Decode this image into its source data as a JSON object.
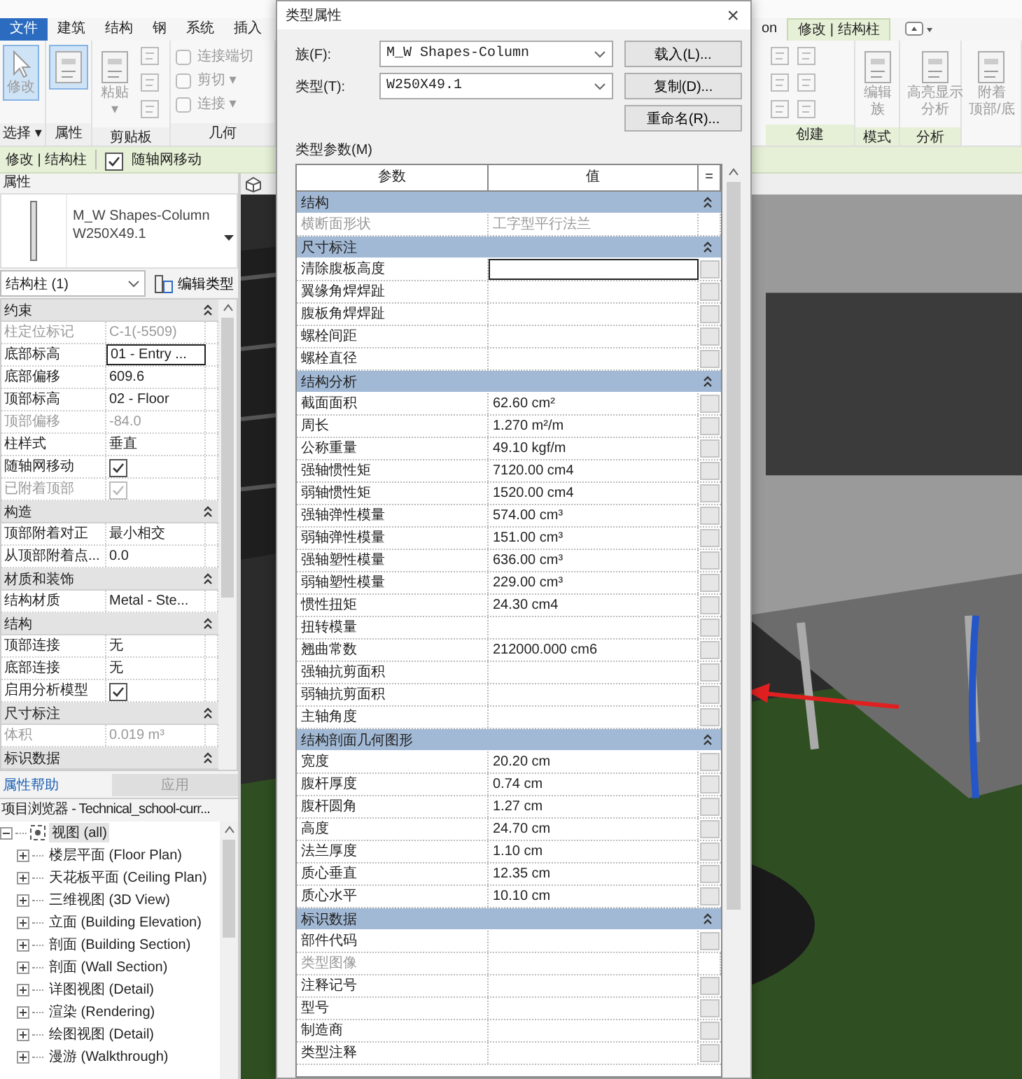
{
  "ribbon": {
    "tabs_left": [
      {
        "label": "文件",
        "kind": "menu",
        "selected": false
      },
      {
        "label": "建筑",
        "kind": "tab",
        "selected": false
      },
      {
        "label": "结构",
        "kind": "tab",
        "selected": false
      },
      {
        "label": "钢",
        "kind": "tab",
        "selected": false
      },
      {
        "label": "系统",
        "kind": "tab",
        "selected": false
      },
      {
        "label": "插入",
        "kind": "tab",
        "selected": false
      }
    ],
    "tabs_right": [
      {
        "label": "on",
        "selected": false
      },
      {
        "label": "修改 | 结构柱",
        "selected": true
      }
    ],
    "panels_left": [
      {
        "label": "选择 ▾",
        "tools": [
          {
            "kind": "large",
            "lines": [
              "修改"
            ],
            "disabled": true,
            "selected": true
          }
        ]
      },
      {
        "label": "属性",
        "tools": [
          {
            "kind": "large",
            "selected": true
          }
        ]
      },
      {
        "label": "剪贴板",
        "tools": [
          {
            "kind": "large",
            "lines": [
              "粘贴",
              "▾"
            ],
            "disabled": true,
            "selected": false
          },
          {
            "kind": "icons"
          }
        ]
      },
      {
        "label": "几何",
        "tools": [
          {
            "kind": "small",
            "lines": [
              "连接端切"
            ],
            "disabled": true
          },
          {
            "kind": "small",
            "lines": [
              "剪切 ▾"
            ],
            "disabled": true
          },
          {
            "kind": "small",
            "lines": [
              "连接 ▾"
            ],
            "disabled": true
          }
        ]
      }
    ],
    "panels_right": [
      {
        "label": "创建",
        "tools": [
          {
            "kind": "icons"
          },
          {
            "kind": "icons"
          }
        ]
      },
      {
        "label": "模式",
        "tools": [
          {
            "kind": "large",
            "lines": [
              "编辑",
              "族"
            ],
            "disabled": true,
            "selected": false
          }
        ]
      },
      {
        "label": "分析",
        "tools": [
          {
            "kind": "large",
            "lines": [
              "高亮显示",
              "分析"
            ],
            "disabled": true,
            "selected": false
          }
        ]
      },
      {
        "tools": [
          {
            "kind": "large",
            "lines": [
              "附着",
              "顶部/底"
            ],
            "disabled": true,
            "selected": false
          }
        ]
      }
    ]
  },
  "context_bar": {
    "label": "修改 | 结构柱",
    "option": {
      "label": "随轴网移动",
      "checked": true
    }
  },
  "properties": {
    "title": "属性",
    "type_name": "M_W Shapes-Column",
    "type_size": "W250X49.1",
    "filter": "结构柱 (1)",
    "edit_type": "编辑类型",
    "sections": [
      {
        "title": "约束",
        "rows": [
          {
            "kind": "text",
            "label": "柱定位标记",
            "value": "C-1(-5509)",
            "disabled": true
          },
          {
            "kind": "edit",
            "label": "底部标高",
            "value": "01 - Entry ...",
            "disabled": false
          },
          {
            "kind": "text",
            "label": "底部偏移",
            "value": "609.6",
            "disabled": false
          },
          {
            "kind": "text",
            "label": "顶部标高",
            "value": "02 - Floor",
            "disabled": false
          },
          {
            "kind": "text",
            "label": "顶部偏移",
            "value": "-84.0",
            "disabled": true
          },
          {
            "kind": "text",
            "label": "柱样式",
            "value": "垂直",
            "disabled": false
          },
          {
            "kind": "check",
            "label": "随轴网移动",
            "checked": true,
            "disabled": false
          },
          {
            "kind": "check",
            "label": "已附着顶部",
            "checked": true,
            "disabled": true
          }
        ]
      },
      {
        "title": "构造",
        "rows": [
          {
            "kind": "text",
            "label": "顶部附着对正",
            "value": "最小相交",
            "disabled": false
          },
          {
            "kind": "text",
            "label": "从顶部附着点...",
            "value": "0.0",
            "disabled": false
          }
        ]
      },
      {
        "title": "材质和装饰",
        "rows": [
          {
            "kind": "text",
            "label": "结构材质",
            "value": "Metal - Ste...",
            "disabled": false
          }
        ]
      },
      {
        "title": "结构",
        "rows": [
          {
            "kind": "text",
            "label": "顶部连接",
            "value": "无",
            "disabled": false
          },
          {
            "kind": "text",
            "label": "底部连接",
            "value": "无",
            "disabled": false
          },
          {
            "kind": "check",
            "label": "启用分析模型",
            "checked": true,
            "disabled": false
          }
        ]
      },
      {
        "title": "尺寸标注",
        "rows": [
          {
            "kind": "text",
            "label": "体积",
            "value": "0.019 m³",
            "disabled": true
          }
        ]
      },
      {
        "title": "标识数据"
      }
    ],
    "help": "属性帮助",
    "apply": {
      "label": "应用",
      "disabled": true
    }
  },
  "browser": {
    "title": "项目浏览器 - Technical_school-curr...",
    "tree": [
      {
        "label": "视图 (all)",
        "expanded": true,
        "selected": true,
        "children": [
          {
            "label": "楼层平面 (Floor Plan)",
            "expanded": false,
            "selected": false
          },
          {
            "label": "天花板平面 (Ceiling Plan)",
            "expanded": false,
            "selected": false
          },
          {
            "label": "三维视图 (3D View)",
            "expanded": false,
            "selected": false
          },
          {
            "label": "立面 (Building Elevation)",
            "expanded": false,
            "selected": false
          },
          {
            "label": "剖面 (Building Section)",
            "expanded": false,
            "selected": false
          },
          {
            "label": "剖面 (Wall Section)",
            "expanded": false,
            "selected": false
          },
          {
            "label": "详图视图 (Detail)",
            "expanded": false,
            "selected": false
          },
          {
            "label": "渲染 (Rendering)",
            "expanded": false,
            "selected": false
          },
          {
            "label": "绘图视图 (Detail)",
            "expanded": false,
            "selected": false
          },
          {
            "label": "漫游 (Walkthrough)",
            "expanded": false,
            "selected": false
          }
        ]
      }
    ]
  },
  "dialog": {
    "title": "类型属性",
    "close": "×",
    "family_label": "族(F):",
    "family": "M_W Shapes-Column",
    "type_label": "类型(T):",
    "type": "W250X49.1",
    "buttons": [
      "载入(L)...",
      "复制(D)...",
      "重命名(R)..."
    ],
    "params_label": "类型参数(M)",
    "columns": [
      "参数",
      "值",
      "="
    ],
    "sections": [
      {
        "title": "结构",
        "rows": [
          {
            "label": "横断面形状",
            "value": "工字型平行法兰",
            "disabled": true
          }
        ]
      },
      {
        "title": "尺寸标注",
        "rows": [
          {
            "label": "清除腹板高度",
            "disabled": false,
            "editing": true
          },
          {
            "label": "翼缘角焊焊趾",
            "disabled": false
          },
          {
            "label": "腹板角焊焊趾",
            "disabled": false
          },
          {
            "label": "螺栓间距",
            "disabled": false
          },
          {
            "label": "螺栓直径",
            "disabled": false
          }
        ]
      },
      {
        "title": "结构分析",
        "rows": [
          {
            "label": "截面面积",
            "value": "62.60 cm²",
            "disabled": false
          },
          {
            "label": "周长",
            "value": "1.270 m²/m",
            "disabled": false
          },
          {
            "label": "公称重量",
            "value": "49.10 kgf/m",
            "disabled": false
          },
          {
            "label": "强轴惯性矩",
            "value": "7120.00 cm4",
            "disabled": false
          },
          {
            "label": "弱轴惯性矩",
            "value": "1520.00 cm4",
            "disabled": false
          },
          {
            "label": "强轴弹性模量",
            "value": "574.00 cm³",
            "disabled": false
          },
          {
            "label": "弱轴弹性模量",
            "value": "151.00 cm³",
            "disabled": false
          },
          {
            "label": "强轴塑性模量",
            "value": "636.00 cm³",
            "disabled": false
          },
          {
            "label": "弱轴塑性模量",
            "value": "229.00 cm³",
            "disabled": false
          },
          {
            "label": "惯性扭矩",
            "value": "24.30 cm4",
            "disabled": false
          },
          {
            "label": "扭转模量",
            "disabled": false
          },
          {
            "label": "翘曲常数",
            "value": "212000.000 cm6",
            "disabled": false
          },
          {
            "label": "强轴抗剪面积",
            "disabled": false
          },
          {
            "label": "弱轴抗剪面积",
            "disabled": false
          },
          {
            "label": "主轴角度",
            "disabled": false
          }
        ]
      },
      {
        "title": "结构剖面几何图形",
        "rows": [
          {
            "label": "宽度",
            "value": "20.20 cm",
            "disabled": false
          },
          {
            "label": "腹杆厚度",
            "value": "0.74 cm",
            "disabled": false
          },
          {
            "label": "腹杆圆角",
            "value": "1.27 cm",
            "disabled": false
          },
          {
            "label": "高度",
            "value": "24.70 cm",
            "disabled": false
          },
          {
            "label": "法兰厚度",
            "value": "1.10 cm",
            "disabled": false
          },
          {
            "label": "质心垂直",
            "value": "12.35 cm",
            "disabled": false
          },
          {
            "label": "质心水平",
            "value": "10.10 cm",
            "disabled": false
          }
        ]
      },
      {
        "title": "标识数据",
        "rows": [
          {
            "label": "部件代码",
            "disabled": false
          },
          {
            "label": "类型图像",
            "disabled": true
          },
          {
            "label": "注释记号",
            "disabled": false
          },
          {
            "label": "型号",
            "disabled": false
          },
          {
            "label": "制造商",
            "disabled": false
          },
          {
            "label": "类型注释",
            "disabled": false
          }
        ]
      }
    ]
  }
}
